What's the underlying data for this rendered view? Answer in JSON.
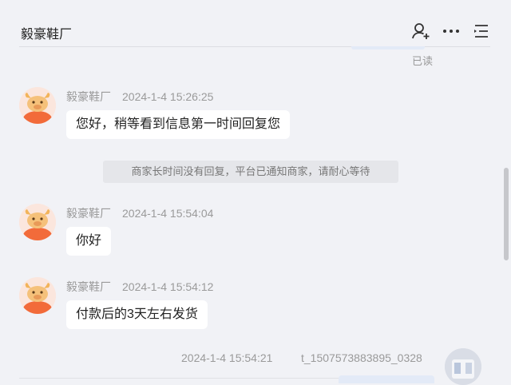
{
  "header": {
    "title": "毅豪鞋厂",
    "icons": [
      "add-user-icon",
      "more-icon",
      "menu-icon"
    ]
  },
  "read_status": "已读",
  "messages": [
    {
      "sender": "毅豪鞋厂",
      "time": "2024-1-4 15:26:25",
      "text": "您好，稍等看到信息第一时间回复您"
    },
    {
      "sender": "毅豪鞋厂",
      "time": "2024-1-4 15:54:04",
      "text": "你好"
    },
    {
      "sender": "毅豪鞋厂",
      "time": "2024-1-4 15:54:12",
      "text": "付款后的3天左右发货"
    }
  ],
  "system_note": "商家长时间没有回复，平台已通知商家，请耐心等待",
  "my_message": {
    "time": "2024-1-4 15:54:21",
    "sender": "t_1507573883895_0328"
  },
  "colors": {
    "background": "#f1f2f6",
    "bubble": "#ffffff",
    "avatar_orange": "#f26b3a",
    "muted_text": "#9a9a9a"
  }
}
